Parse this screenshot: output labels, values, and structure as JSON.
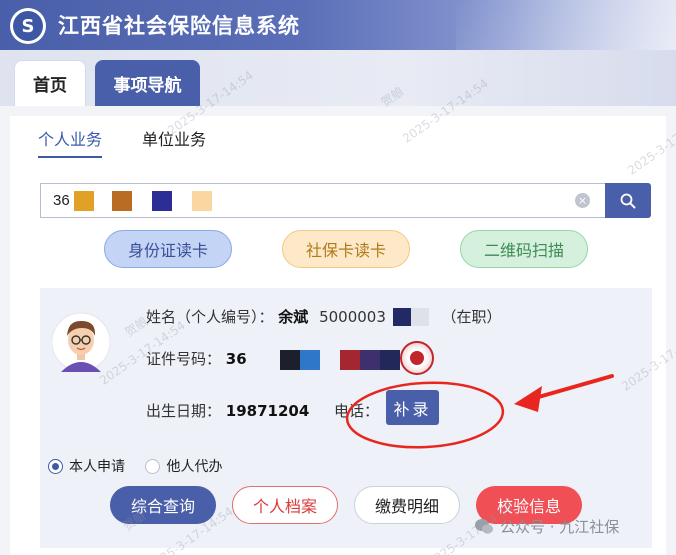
{
  "app": {
    "title": "江西省社会保险信息系统",
    "logo_glyph": "S"
  },
  "tabs": {
    "home": "首页",
    "nav": "事项导航"
  },
  "subtabs": {
    "personal": "个人业务",
    "unit": "单位业务"
  },
  "search": {
    "value": "36"
  },
  "read_buttons": {
    "id_card": "身份证读卡",
    "sb_card": "社保卡读卡",
    "qr_scan": "二维码扫描"
  },
  "person": {
    "name_label": "姓名（个人编号）：",
    "name_value": "余斌",
    "number_value": "5000003",
    "status": "（在职）",
    "id_label": "证件号码：",
    "id_value": "36",
    "birth_label": "出生日期：",
    "birth_value": "19871204",
    "phone_label": "电话：",
    "phone_action": "补录"
  },
  "applicant": {
    "self": "本人申请",
    "agent": "他人代办"
  },
  "actions": {
    "query": "综合查询",
    "archive": "个人档案",
    "payment": "缴费明细",
    "verify": "校验信息"
  },
  "watermark": {
    "text1": "贺艆",
    "text2": "2025-3-17-14:54"
  },
  "footer": {
    "text": "公众号 · 九江社保"
  },
  "colors": {
    "primary": "#4a5fa9",
    "danger": "#ef4f55",
    "annotation": "#e8261f"
  }
}
